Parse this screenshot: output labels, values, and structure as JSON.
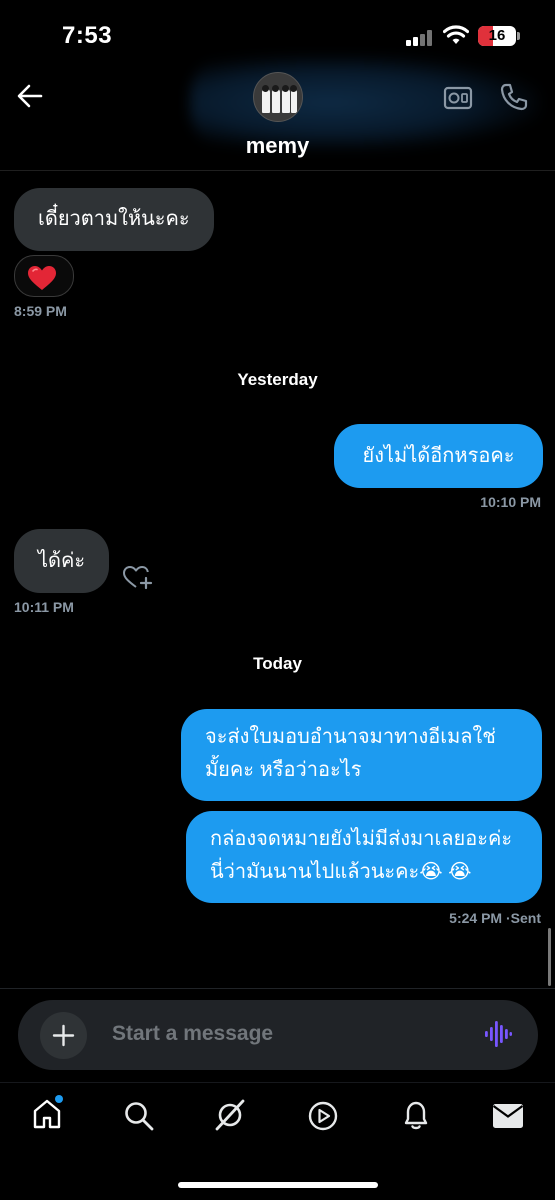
{
  "status": {
    "time": "7:53",
    "battery": "16"
  },
  "header": {
    "contact_name": "memy"
  },
  "messages": [
    {
      "dir": "in",
      "text": "เดี๋ยวตามให้นะคะ",
      "reaction": "❤️",
      "time": "8:59 PM"
    },
    {
      "day": "Yesterday"
    },
    {
      "dir": "out",
      "text": "ยังไม่ได้อีกหรอคะ",
      "time": "10:10 PM"
    },
    {
      "dir": "in",
      "text": "ได้ค่ะ",
      "time": "10:11 PM"
    },
    {
      "day": "Today"
    },
    {
      "dir": "out",
      "text": "จะส่งใบมอบอำนาจมาทางอีเมลใช่มั้ยคะ หรือว่าอะไร"
    },
    {
      "dir": "out",
      "text": "กล่องจดหมายยังไม่มีส่งมาเลยอะค่ะ นี่ว่ามันนานไปแล้วนะคะ😭 😭",
      "time": "5:24 PM",
      "status": "Sent"
    }
  ],
  "composer": {
    "placeholder": "Start a message"
  },
  "nav": {
    "items": [
      "home-icon",
      "search-icon",
      "grok-icon",
      "video-icon",
      "notifications-icon",
      "messages-icon"
    ],
    "badge_on": "home"
  },
  "colors": {
    "accent": "#1d9bf0",
    "incoming_bubble": "#2f3336",
    "background": "#000000"
  }
}
